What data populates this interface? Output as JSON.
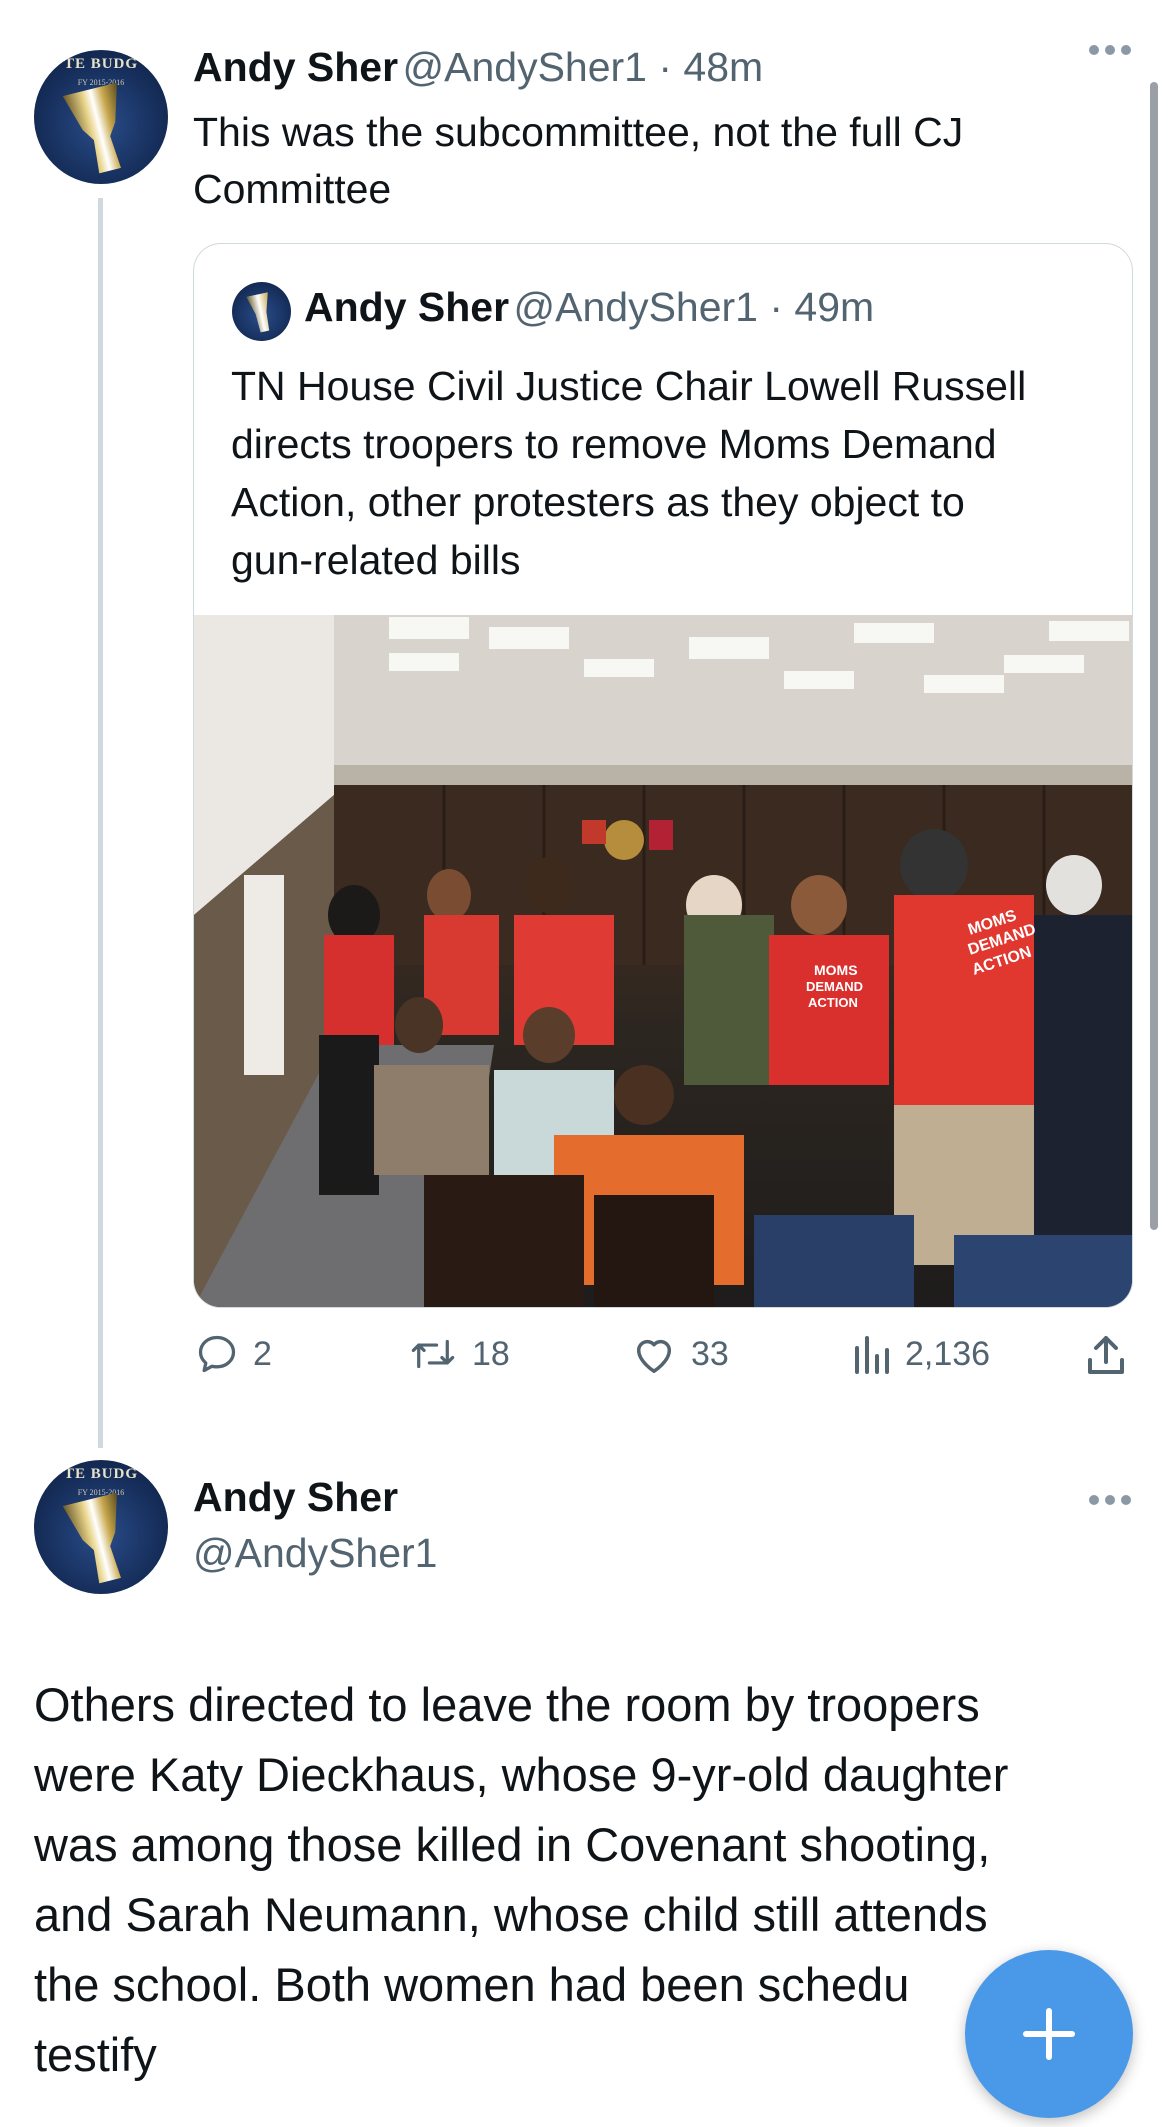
{
  "reply_tweet": {
    "author_name": "Andy Sher",
    "author_handle": "@AndySher1",
    "time": "48m",
    "text_lines": [
      "This was the subcommittee, not the full CJ",
      "Committee"
    ],
    "avatar_text": "TE BUDG",
    "avatar_subtext": "FY 2015-2016"
  },
  "quoted_tweet": {
    "author_name": "Andy Sher",
    "author_handle": "@AndySher1",
    "time": "49m",
    "text_lines": [
      "TN House Civil Justice Chair Lowell Russell",
      "directs troopers to remove Moms Demand",
      "Action, other protesters as they object to",
      "gun-related bills"
    ],
    "photo_shirt_text": [
      "MOMS",
      "DEMAND",
      "ACTION"
    ]
  },
  "metrics": {
    "replies": "2",
    "retweets": "18",
    "likes": "33",
    "views": "2,136"
  },
  "next_tweet": {
    "author_name": "Andy Sher",
    "author_handle": "@AndySher1",
    "avatar_text": "TE BUDG",
    "avatar_subtext": "FY 2015-2016",
    "text_lines": [
      "Others directed to leave the room by troopers",
      "were Katy Dieckhaus, whose 9-yr-old daughter",
      "was among those killed in Covenant shooting,",
      "and Sarah Neumann, whose child still attends",
      "the school. Both women had been schedu",
      "testify"
    ]
  },
  "icons": {
    "more": "more-dots-icon",
    "reply": "reply-icon",
    "retweet": "retweet-icon",
    "like": "heart-icon",
    "views": "views-icon",
    "share": "share-icon",
    "compose": "plus-icon"
  },
  "colors": {
    "accent": "#4a99e9",
    "text": "#0f1419",
    "secondary": "#536471",
    "border": "#cfd9de"
  }
}
